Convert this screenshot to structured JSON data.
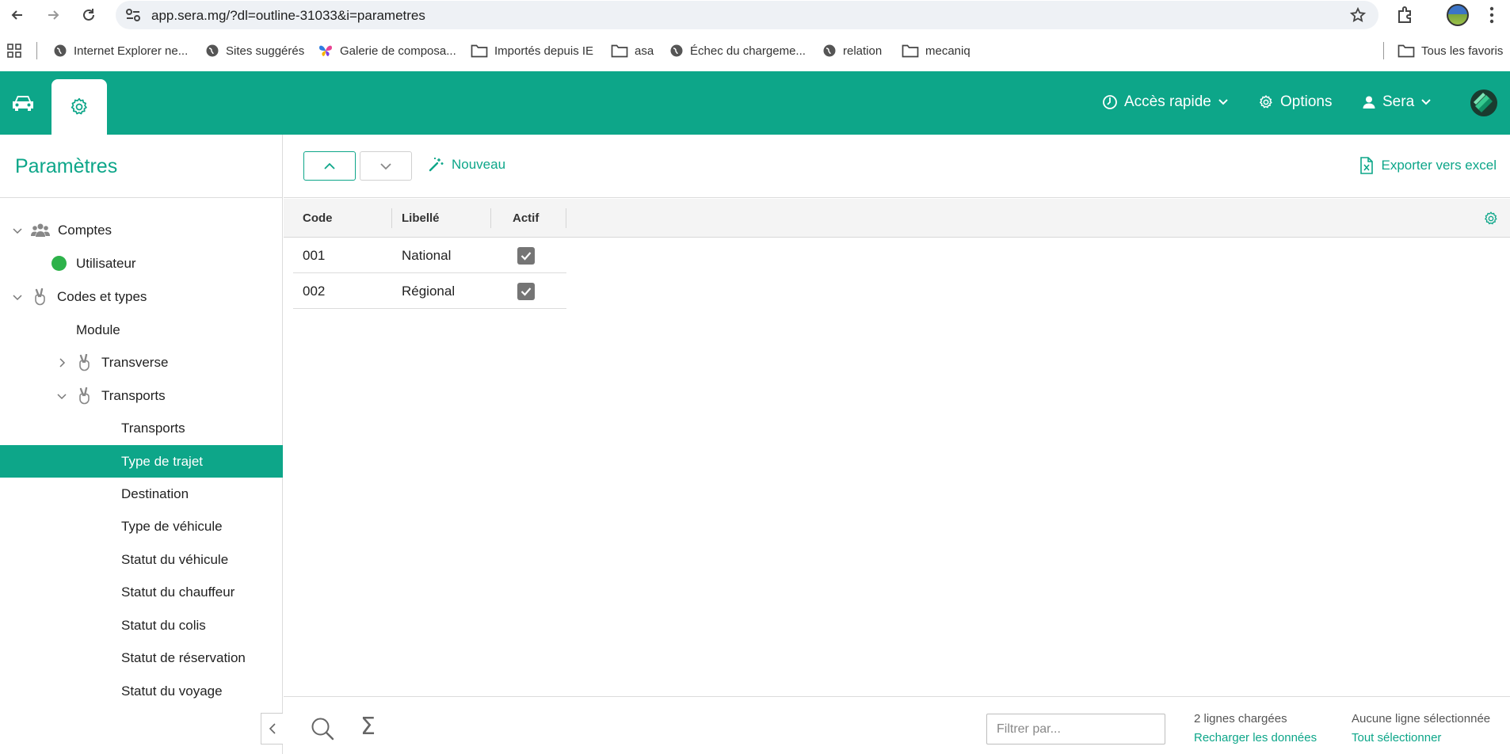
{
  "browser": {
    "url": "app.sera.mg/?dl=outline-31033&i=parametres",
    "bookmarks": [
      {
        "label": "Internet Explorer ne...",
        "icon": "globe-icon"
      },
      {
        "label": "Sites suggérés",
        "icon": "globe-icon"
      },
      {
        "label": "Galerie de composa...",
        "icon": "butterfly-icon"
      },
      {
        "label": "Importés depuis IE",
        "icon": "folder-icon"
      },
      {
        "label": "asa",
        "icon": "folder-icon"
      },
      {
        "label": "Échec du chargeme...",
        "icon": "globe-icon"
      },
      {
        "label": "relation",
        "icon": "globe-icon"
      },
      {
        "label": "mecaniq",
        "icon": "folder-icon"
      }
    ],
    "all_bookmarks": "Tous les favoris"
  },
  "header": {
    "quick_access": "Accès rapide",
    "options": "Options",
    "user": "Sera",
    "accent_color": "#0da689"
  },
  "sidebar": {
    "title": "Paramètres",
    "items": [
      {
        "label": "Comptes",
        "icon": "users-icon",
        "expanded": true
      },
      {
        "label": "Utilisateur",
        "icon": "status-dot-icon"
      },
      {
        "label": "Codes et types",
        "icon": "peace-hand-icon",
        "expanded": true
      },
      {
        "label": "Module"
      },
      {
        "label": "Transverse",
        "icon": "peace-hand-icon",
        "expanded": false
      },
      {
        "label": "Transports",
        "icon": "peace-hand-icon",
        "expanded": true
      },
      {
        "label": "Transports"
      },
      {
        "label": "Type de trajet",
        "selected": true
      },
      {
        "label": "Destination"
      },
      {
        "label": "Type de véhicule"
      },
      {
        "label": "Statut du véhicule"
      },
      {
        "label": "Statut du chauffeur"
      },
      {
        "label": "Statut du colis"
      },
      {
        "label": "Statut de réservation"
      },
      {
        "label": "Statut du voyage"
      }
    ]
  },
  "toolbar": {
    "new_label": "Nouveau",
    "export_label": "Exporter vers excel"
  },
  "grid": {
    "columns": [
      "Code",
      "Libellé",
      "Actif"
    ],
    "rows": [
      {
        "code": "001",
        "label": "National",
        "active": true
      },
      {
        "code": "002",
        "label": "Régional",
        "active": true
      }
    ]
  },
  "footer": {
    "filter_placeholder": "Filtrer par...",
    "rows_loaded": "2 lignes chargées",
    "reload": "Recharger les données",
    "no_selection": "Aucune ligne sélectionnée",
    "select_all": "Tout sélectionner"
  }
}
